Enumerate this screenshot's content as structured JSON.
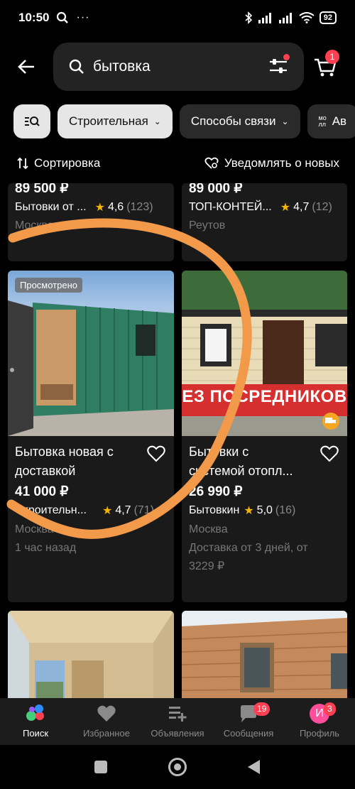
{
  "status": {
    "time": "10:50",
    "battery": "92",
    "signal": "signal-icon",
    "wifi": "wifi-icon"
  },
  "search": {
    "query": "бытовка",
    "cart_count": "1"
  },
  "chips": [
    {
      "label": "",
      "icon": "list-search-icon"
    },
    {
      "label": "Строительная"
    },
    {
      "label": "Способы связи"
    },
    {
      "label": "Ав"
    }
  ],
  "sort": {
    "sort_label": "Сортировка",
    "notify_label": "Уведомлять о новых"
  },
  "listings": [
    {
      "price": "89 500 ₽",
      "seller": "Бытовки от ...",
      "rating": "4,6",
      "reviews": "(123)",
      "location": "Москва"
    },
    {
      "price": "89 000 ₽",
      "seller": "ТОП-КОНТЕЙ...",
      "rating": "4,7",
      "reviews": "(12)",
      "location": "Реутов"
    },
    {
      "badge": "Просмотрено",
      "title_line1": "Бытовка новая с",
      "title_line2": "доставкой",
      "price": "41 000 ₽",
      "seller": "Строительн...",
      "rating": "4,7",
      "reviews": "(71)",
      "location": "Москва",
      "time": "1 час назад"
    },
    {
      "banner": "ЕЗ ПОСРЕДНИКОВ",
      "title_line1": "Бытовки с",
      "title_line2": "системой отопл...",
      "price": "26 990 ₽",
      "seller": "Бытовкин",
      "rating": "5,0",
      "reviews": "(16)",
      "location": "Москва",
      "delivery_line1": "Доставка от 3 дней, от",
      "delivery_line2": "3229 ₽"
    }
  ],
  "nav": [
    {
      "label": "Поиск",
      "icon": "search-nav-icon",
      "active": true
    },
    {
      "label": "Избранное",
      "icon": "heart-nav-icon"
    },
    {
      "label": "Объявления",
      "icon": "ads-nav-icon"
    },
    {
      "label": "Сообщения",
      "icon": "messages-nav-icon",
      "badge": "19"
    },
    {
      "label": "Профиль",
      "icon": "profile-nav-icon",
      "badge": "3",
      "avatar_letter": "И"
    }
  ],
  "colors": {
    "accent": "#ff4053",
    "star": "#f5b400",
    "annotation": "#f2994a"
  }
}
